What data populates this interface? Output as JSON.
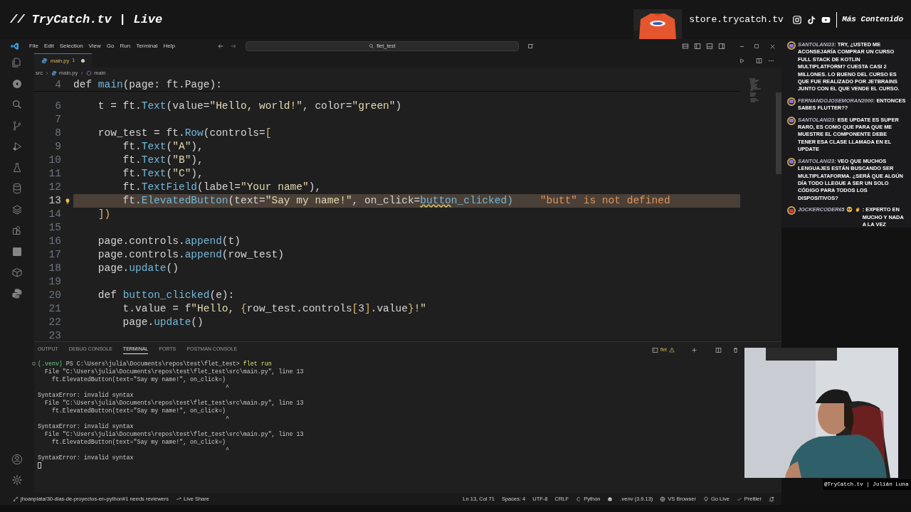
{
  "stream_header": {
    "title": "// TryCatch.tv | Live",
    "store": "store.trycatch.tv",
    "more": "Más Contenido"
  },
  "title_bar": {
    "menus": [
      "File",
      "Edit",
      "Selection",
      "View",
      "Go",
      "Run",
      "Terminal",
      "Help"
    ],
    "search": "flet_test"
  },
  "tabs": [
    {
      "label": "main.py",
      "problems": "1",
      "modified": true,
      "selected": true
    }
  ],
  "breadcrumbs": [
    "src",
    "main.py",
    "main"
  ],
  "editor": {
    "sticky_line": {
      "number": "4",
      "tokens": [
        {
          "text": "def ",
          "kind": "plain"
        },
        {
          "text": "main",
          "kind": "name"
        },
        {
          "text": "(page: ft.",
          "kind": "plain"
        },
        {
          "text": "Page",
          "kind": "plain"
        },
        {
          "text": "):",
          "kind": "plain"
        }
      ]
    },
    "lines": [
      {
        "number": "6",
        "current": false,
        "tokens": [
          {
            "text": "    t = ft.",
            "kind": "plain"
          },
          {
            "text": "Text",
            "kind": "name"
          },
          {
            "text": "(value=",
            "kind": "plain"
          },
          {
            "text": "\"Hello, world!\"",
            "kind": "string"
          },
          {
            "text": ", color=",
            "kind": "plain"
          },
          {
            "text": "\"green\"",
            "kind": "string"
          },
          {
            "text": ")",
            "kind": "plain"
          }
        ]
      },
      {
        "number": "7",
        "current": false
      },
      {
        "number": "8",
        "current": false,
        "tokens": [
          {
            "text": "    row_test = ft.",
            "kind": "plain"
          },
          {
            "text": "Row",
            "kind": "name"
          },
          {
            "text": "(controls=",
            "kind": "plain"
          },
          {
            "text": "[",
            "kind": "bracket"
          }
        ]
      },
      {
        "number": "9",
        "current": false,
        "tokens": [
          {
            "text": "        ft.",
            "kind": "plain"
          },
          {
            "text": "Text",
            "kind": "name"
          },
          {
            "text": "(",
            "kind": "plain"
          },
          {
            "text": "\"A\"",
            "kind": "string"
          },
          {
            "text": "),",
            "kind": "plain"
          }
        ]
      },
      {
        "number": "10",
        "current": false,
        "tokens": [
          {
            "text": "        ft.",
            "kind": "plain"
          },
          {
            "text": "Text",
            "kind": "name"
          },
          {
            "text": "(",
            "kind": "plain"
          },
          {
            "text": "\"B\"",
            "kind": "string"
          },
          {
            "text": "),",
            "kind": "plain"
          }
        ]
      },
      {
        "number": "11",
        "current": false,
        "tokens": [
          {
            "text": "        ft.",
            "kind": "plain"
          },
          {
            "text": "Text",
            "kind": "name"
          },
          {
            "text": "(",
            "kind": "plain"
          },
          {
            "text": "\"C\"",
            "kind": "string"
          },
          {
            "text": "),",
            "kind": "plain"
          }
        ]
      },
      {
        "number": "12",
        "current": false,
        "tokens": [
          {
            "text": "        ft.",
            "kind": "plain"
          },
          {
            "text": "TextField",
            "kind": "name"
          },
          {
            "text": "(label=",
            "kind": "plain"
          },
          {
            "text": "\"Your name\"",
            "kind": "string"
          },
          {
            "text": "),",
            "kind": "plain"
          }
        ]
      },
      {
        "number": "13",
        "current": true,
        "diagnostic": "\"butt\" is not defined",
        "tokens": [
          {
            "text": "        ft.",
            "kind": "plain"
          },
          {
            "text": "ElevatedButton",
            "kind": "name"
          },
          {
            "text": "(text=",
            "kind": "plain"
          },
          {
            "text": "\"Say my name!\"",
            "kind": "string"
          },
          {
            "text": ", on_click=",
            "kind": "plain"
          },
          {
            "text": "butto",
            "kind": "squiggle"
          },
          {
            "text": "n_clicked",
            "kind": "name"
          },
          {
            "text": ")",
            "kind": "name"
          }
        ]
      },
      {
        "number": "14",
        "current": false,
        "tokens": [
          {
            "text": "    ])",
            "kind": "bracket"
          }
        ]
      },
      {
        "number": "15",
        "current": false
      },
      {
        "number": "16",
        "current": false,
        "tokens": [
          {
            "text": "    page.controls.",
            "kind": "plain"
          },
          {
            "text": "append",
            "kind": "name"
          },
          {
            "text": "(t)",
            "kind": "plain"
          }
        ]
      },
      {
        "number": "17",
        "current": false,
        "tokens": [
          {
            "text": "    page.controls.",
            "kind": "plain"
          },
          {
            "text": "append",
            "kind": "name"
          },
          {
            "text": "(row_test)",
            "kind": "plain"
          }
        ]
      },
      {
        "number": "18",
        "current": false,
        "tokens": [
          {
            "text": "    page.",
            "kind": "plain"
          },
          {
            "text": "update",
            "kind": "name"
          },
          {
            "text": "()",
            "kind": "plain"
          }
        ]
      },
      {
        "number": "19",
        "current": false
      },
      {
        "number": "20",
        "current": false,
        "tokens": [
          {
            "text": "    def ",
            "kind": "plain"
          },
          {
            "text": "button_clicked",
            "kind": "name"
          },
          {
            "text": "(e):",
            "kind": "plain"
          }
        ]
      },
      {
        "number": "21",
        "current": false,
        "tokens": [
          {
            "text": "        t.value = f",
            "kind": "plain"
          },
          {
            "text": "\"Hello, ",
            "kind": "string"
          },
          {
            "text": "{",
            "kind": "bracket"
          },
          {
            "text": "row_test.controls",
            "kind": "plain"
          },
          {
            "text": "[",
            "kind": "bracket"
          },
          {
            "text": "3",
            "kind": "plain"
          },
          {
            "text": "]",
            "kind": "bracket"
          },
          {
            "text": ".value",
            "kind": "plain"
          },
          {
            "text": "}",
            "kind": "bracket"
          },
          {
            "text": "!\"",
            "kind": "string"
          }
        ]
      },
      {
        "number": "22",
        "current": false,
        "tokens": [
          {
            "text": "        page.",
            "kind": "plain"
          },
          {
            "text": "update",
            "kind": "name"
          },
          {
            "text": "()",
            "kind": "plain"
          }
        ]
      },
      {
        "number": "23",
        "current": false
      }
    ]
  },
  "panel": {
    "tabs": [
      {
        "label": "OUTPUT",
        "selected": false
      },
      {
        "label": "DEBUG CONSOLE",
        "selected": false
      },
      {
        "label": "TERMINAL",
        "selected": true
      },
      {
        "label": "PORTS",
        "selected": false
      },
      {
        "label": "POSTMAN CONSOLE",
        "selected": false
      }
    ],
    "terminal_name": "flet",
    "prompt": {
      "env": "(.venv)",
      "path": "PS C:\\Users\\julia\\Documents\\repos\\test\\flet_test>",
      "command": "flet run"
    },
    "output": [
      "  File \"C:\\Users\\julia\\Documents\\repos\\test\\flet_test\\src\\main.py\", line 13",
      "    ft.ElevatedButton(text=\"Say my name!\", on_click=)",
      "                                                     ^",
      "SyntaxError: invalid syntax",
      "  File \"C:\\Users\\julia\\Documents\\repos\\test\\flet_test\\src\\main.py\", line 13",
      "    ft.ElevatedButton(text=\"Say my name!\", on_click=)",
      "                                                     ^",
      "SyntaxError: invalid syntax",
      "  File \"C:\\Users\\julia\\Documents\\repos\\test\\flet_test\\src\\main.py\", line 13",
      "    ft.ElevatedButton(text=\"Say my name!\", on_click=)",
      "                                                     ^",
      "SyntaxError: invalid syntax"
    ]
  },
  "status_bar": {
    "left": [
      {
        "kind": "pull_request",
        "text": "jhoanplata/30-dias-de-proyectos-en-python#1 needs reviewers"
      },
      {
        "kind": "live_share",
        "text": "Live Share"
      }
    ],
    "right": [
      {
        "kind": "text",
        "text": "Ln 13, Col 71"
      },
      {
        "kind": "text",
        "text": "Spaces: 4"
      },
      {
        "kind": "text",
        "text": "UTF-8"
      },
      {
        "kind": "text",
        "text": "CRLF"
      },
      {
        "kind": "language",
        "text": "Python"
      },
      {
        "kind": "copilot"
      },
      {
        "kind": "text",
        "text": ".venv (3.9.13)"
      },
      {
        "kind": "browser",
        "text": "VS Browser"
      },
      {
        "kind": "live",
        "text": "Go Live"
      },
      {
        "kind": "check",
        "text": "Prettier"
      },
      {
        "kind": "bell"
      }
    ]
  },
  "chat": [
    {
      "user": "SANTOLANI23:",
      "text": "TRY, ¿USTED ME ACONSEJARÍA COMPRAR UN CURSO FULL STACK DE KOTLIN MULTIPLATFORM? CUESTA CASI 2 MILLONES. LO BUENO DEL CURSO ES QUE FUE REALIZADO POR JETBRAINS JUNTO CON EL QUE VENDE EL CURSO.",
      "color": "#8e6fd6",
      "has_emotes": false
    },
    {
      "user": "FERNANDOJOSEMORAN2000:",
      "text": "ENTONCES SABES FLUTTER??",
      "color": "#8e6fd6",
      "has_emotes": false
    },
    {
      "user": "SANTOLANI23:",
      "text": "ESE UPDATE ES SUPER RARO, ES COMO QUE PARA QUE ME MUESTRE EL COMPONENTE DEBE TENER ESA CLASE LLAMADA EN EL UPDATE",
      "color": "#8e6fd6",
      "has_emotes": false
    },
    {
      "user": "SANTOLANI23:",
      "text": "VEO QUE MUCHOS LENGUAJES ESTÁN BUSCANDO SER MULTIPLATAFORMA. ¿SERÁ QUE ALGÚN DÍA TODO LLEGUE A SER UN SOLO CÓDIGO PARA TODOS LOS DISPOSITIVOS?",
      "color": "#8e6fd6",
      "has_emotes": false
    },
    {
      "user": "JOCKERCODER65",
      "text": ": EXPERTO EN MUCHO Y NADA A LA VEZ",
      "color": "#d33a3a",
      "has_emotes": true
    }
  ],
  "webcam": {
    "caption": "@TryCatch.tv | Julián Luna"
  }
}
